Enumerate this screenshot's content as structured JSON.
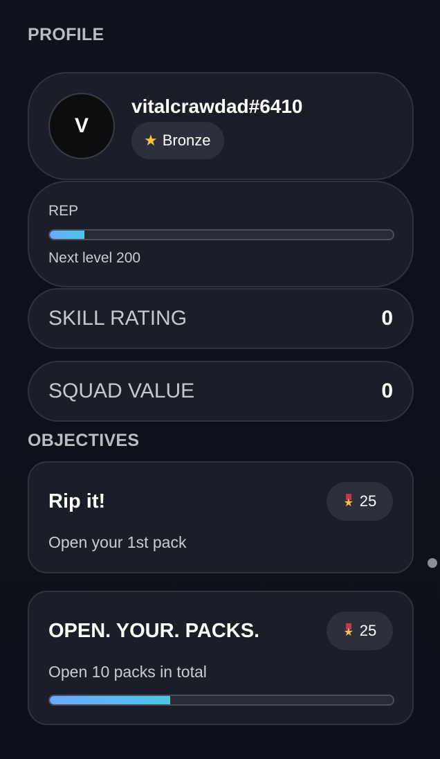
{
  "profile": {
    "section_title": "PROFILE",
    "avatar_initial": "V",
    "username": "vitalcrawdad#6410",
    "rank": {
      "icon": "star-icon",
      "label": "Bronze"
    }
  },
  "rep": {
    "label": "REP",
    "progress_fraction": 0.1,
    "next_level_text": "Next level 200"
  },
  "stats": {
    "skill_rating": {
      "label": "SKILL RATING",
      "value": "0"
    },
    "squad_value": {
      "label": "SQUAD VALUE",
      "value": "0"
    }
  },
  "objectives": {
    "section_title": "OBJECTIVES",
    "items": [
      {
        "title": "Rip it!",
        "description": "Open your 1st pack",
        "reward": "25",
        "reward_icon": "medal-icon"
      },
      {
        "title": "OPEN. YOUR. PACKS.",
        "description": "Open 10 packs in total",
        "reward": "25",
        "reward_icon": "medal-icon",
        "progress_fraction": 0.35
      }
    ]
  },
  "colors": {
    "background": "#0e111b",
    "card": "#1b1e29",
    "progress_start": "#6aa8ff",
    "progress_end": "#4cc8e8",
    "rank_star": "#f5c542"
  }
}
